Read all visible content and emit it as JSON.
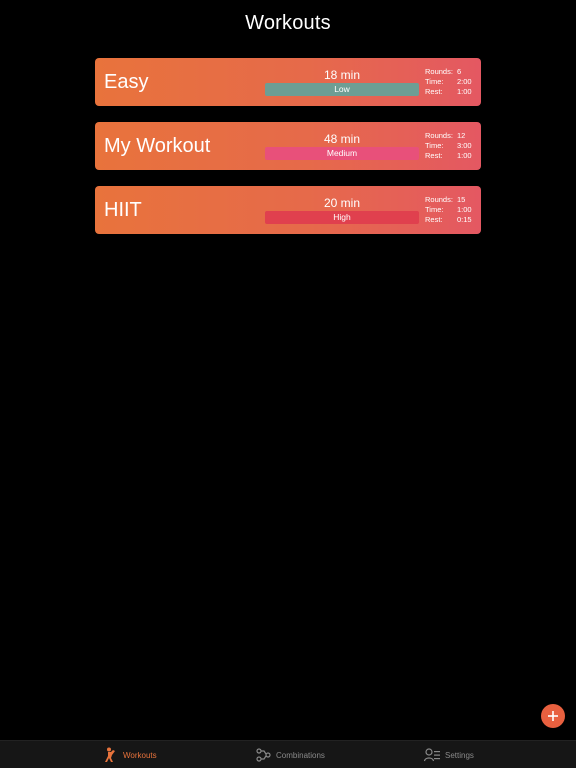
{
  "header": {
    "title": "Workouts"
  },
  "workouts": [
    {
      "name": "Easy",
      "duration": "18 min",
      "intensity": "Low",
      "stats": [
        {
          "label": "Rounds:",
          "value": "6"
        },
        {
          "label": "Time:",
          "value": "2:00"
        },
        {
          "label": "Rest:",
          "value": "1:00"
        }
      ]
    },
    {
      "name": "My Workout",
      "duration": "48 min",
      "intensity": "Medium",
      "stats": [
        {
          "label": "Rounds:",
          "value": "12"
        },
        {
          "label": "Time:",
          "value": "3:00"
        },
        {
          "label": "Rest:",
          "value": "1:00"
        }
      ]
    },
    {
      "name": "HIIT",
      "duration": "20 min",
      "intensity": "High",
      "stats": [
        {
          "label": "Rounds:",
          "value": "15"
        },
        {
          "label": "Time:",
          "value": "1:00"
        },
        {
          "label": "Rest:",
          "value": "0:15"
        }
      ]
    }
  ],
  "fab": {
    "icon": "plus-icon"
  },
  "tabs": [
    {
      "label": "Workouts",
      "icon": "boxer-icon",
      "active": true
    },
    {
      "label": "Combinations",
      "icon": "combinations-icon",
      "active": false
    },
    {
      "label": "Settings",
      "icon": "settings-user-icon",
      "active": false
    }
  ],
  "colors": {
    "accent": "#e8733c",
    "card_gradient_start": "#e8733c",
    "card_gradient_end": "#e45862",
    "low": "#6d9e94",
    "medium": "#e8507a",
    "high": "#e0404e",
    "tab_inactive": "#8a8a8a"
  }
}
